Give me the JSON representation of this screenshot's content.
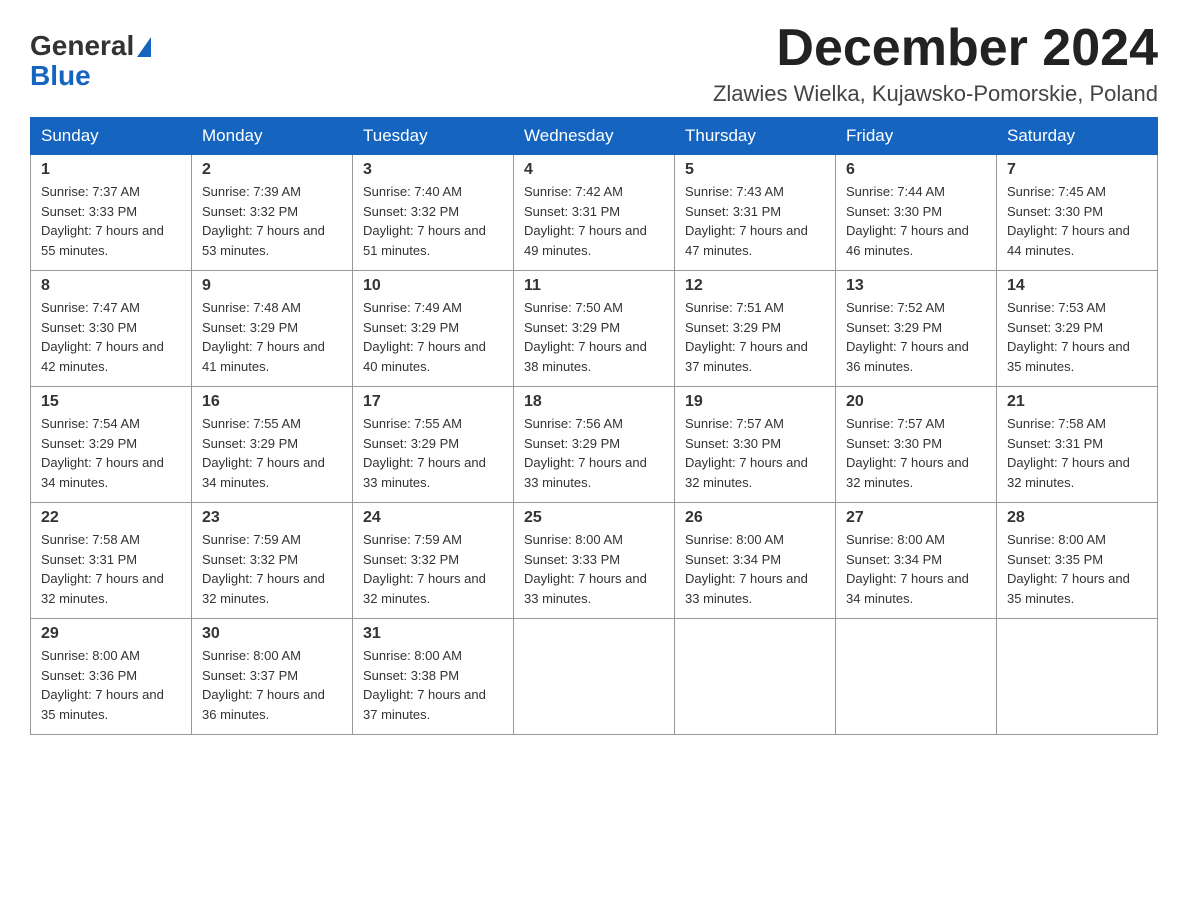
{
  "logo": {
    "line1": "General",
    "line2": "Blue"
  },
  "header": {
    "month_year": "December 2024",
    "location": "Zlawies Wielka, Kujawsko-Pomorskie, Poland"
  },
  "weekdays": [
    "Sunday",
    "Monday",
    "Tuesday",
    "Wednesday",
    "Thursday",
    "Friday",
    "Saturday"
  ],
  "weeks": [
    [
      {
        "day": "1",
        "sunrise": "Sunrise: 7:37 AM",
        "sunset": "Sunset: 3:33 PM",
        "daylight": "Daylight: 7 hours and 55 minutes."
      },
      {
        "day": "2",
        "sunrise": "Sunrise: 7:39 AM",
        "sunset": "Sunset: 3:32 PM",
        "daylight": "Daylight: 7 hours and 53 minutes."
      },
      {
        "day": "3",
        "sunrise": "Sunrise: 7:40 AM",
        "sunset": "Sunset: 3:32 PM",
        "daylight": "Daylight: 7 hours and 51 minutes."
      },
      {
        "day": "4",
        "sunrise": "Sunrise: 7:42 AM",
        "sunset": "Sunset: 3:31 PM",
        "daylight": "Daylight: 7 hours and 49 minutes."
      },
      {
        "day": "5",
        "sunrise": "Sunrise: 7:43 AM",
        "sunset": "Sunset: 3:31 PM",
        "daylight": "Daylight: 7 hours and 47 minutes."
      },
      {
        "day": "6",
        "sunrise": "Sunrise: 7:44 AM",
        "sunset": "Sunset: 3:30 PM",
        "daylight": "Daylight: 7 hours and 46 minutes."
      },
      {
        "day": "7",
        "sunrise": "Sunrise: 7:45 AM",
        "sunset": "Sunset: 3:30 PM",
        "daylight": "Daylight: 7 hours and 44 minutes."
      }
    ],
    [
      {
        "day": "8",
        "sunrise": "Sunrise: 7:47 AM",
        "sunset": "Sunset: 3:30 PM",
        "daylight": "Daylight: 7 hours and 42 minutes."
      },
      {
        "day": "9",
        "sunrise": "Sunrise: 7:48 AM",
        "sunset": "Sunset: 3:29 PM",
        "daylight": "Daylight: 7 hours and 41 minutes."
      },
      {
        "day": "10",
        "sunrise": "Sunrise: 7:49 AM",
        "sunset": "Sunset: 3:29 PM",
        "daylight": "Daylight: 7 hours and 40 minutes."
      },
      {
        "day": "11",
        "sunrise": "Sunrise: 7:50 AM",
        "sunset": "Sunset: 3:29 PM",
        "daylight": "Daylight: 7 hours and 38 minutes."
      },
      {
        "day": "12",
        "sunrise": "Sunrise: 7:51 AM",
        "sunset": "Sunset: 3:29 PM",
        "daylight": "Daylight: 7 hours and 37 minutes."
      },
      {
        "day": "13",
        "sunrise": "Sunrise: 7:52 AM",
        "sunset": "Sunset: 3:29 PM",
        "daylight": "Daylight: 7 hours and 36 minutes."
      },
      {
        "day": "14",
        "sunrise": "Sunrise: 7:53 AM",
        "sunset": "Sunset: 3:29 PM",
        "daylight": "Daylight: 7 hours and 35 minutes."
      }
    ],
    [
      {
        "day": "15",
        "sunrise": "Sunrise: 7:54 AM",
        "sunset": "Sunset: 3:29 PM",
        "daylight": "Daylight: 7 hours and 34 minutes."
      },
      {
        "day": "16",
        "sunrise": "Sunrise: 7:55 AM",
        "sunset": "Sunset: 3:29 PM",
        "daylight": "Daylight: 7 hours and 34 minutes."
      },
      {
        "day": "17",
        "sunrise": "Sunrise: 7:55 AM",
        "sunset": "Sunset: 3:29 PM",
        "daylight": "Daylight: 7 hours and 33 minutes."
      },
      {
        "day": "18",
        "sunrise": "Sunrise: 7:56 AM",
        "sunset": "Sunset: 3:29 PM",
        "daylight": "Daylight: 7 hours and 33 minutes."
      },
      {
        "day": "19",
        "sunrise": "Sunrise: 7:57 AM",
        "sunset": "Sunset: 3:30 PM",
        "daylight": "Daylight: 7 hours and 32 minutes."
      },
      {
        "day": "20",
        "sunrise": "Sunrise: 7:57 AM",
        "sunset": "Sunset: 3:30 PM",
        "daylight": "Daylight: 7 hours and 32 minutes."
      },
      {
        "day": "21",
        "sunrise": "Sunrise: 7:58 AM",
        "sunset": "Sunset: 3:31 PM",
        "daylight": "Daylight: 7 hours and 32 minutes."
      }
    ],
    [
      {
        "day": "22",
        "sunrise": "Sunrise: 7:58 AM",
        "sunset": "Sunset: 3:31 PM",
        "daylight": "Daylight: 7 hours and 32 minutes."
      },
      {
        "day": "23",
        "sunrise": "Sunrise: 7:59 AM",
        "sunset": "Sunset: 3:32 PM",
        "daylight": "Daylight: 7 hours and 32 minutes."
      },
      {
        "day": "24",
        "sunrise": "Sunrise: 7:59 AM",
        "sunset": "Sunset: 3:32 PM",
        "daylight": "Daylight: 7 hours and 32 minutes."
      },
      {
        "day": "25",
        "sunrise": "Sunrise: 8:00 AM",
        "sunset": "Sunset: 3:33 PM",
        "daylight": "Daylight: 7 hours and 33 minutes."
      },
      {
        "day": "26",
        "sunrise": "Sunrise: 8:00 AM",
        "sunset": "Sunset: 3:34 PM",
        "daylight": "Daylight: 7 hours and 33 minutes."
      },
      {
        "day": "27",
        "sunrise": "Sunrise: 8:00 AM",
        "sunset": "Sunset: 3:34 PM",
        "daylight": "Daylight: 7 hours and 34 minutes."
      },
      {
        "day": "28",
        "sunrise": "Sunrise: 8:00 AM",
        "sunset": "Sunset: 3:35 PM",
        "daylight": "Daylight: 7 hours and 35 minutes."
      }
    ],
    [
      {
        "day": "29",
        "sunrise": "Sunrise: 8:00 AM",
        "sunset": "Sunset: 3:36 PM",
        "daylight": "Daylight: 7 hours and 35 minutes."
      },
      {
        "day": "30",
        "sunrise": "Sunrise: 8:00 AM",
        "sunset": "Sunset: 3:37 PM",
        "daylight": "Daylight: 7 hours and 36 minutes."
      },
      {
        "day": "31",
        "sunrise": "Sunrise: 8:00 AM",
        "sunset": "Sunset: 3:38 PM",
        "daylight": "Daylight: 7 hours and 37 minutes."
      },
      null,
      null,
      null,
      null
    ]
  ]
}
